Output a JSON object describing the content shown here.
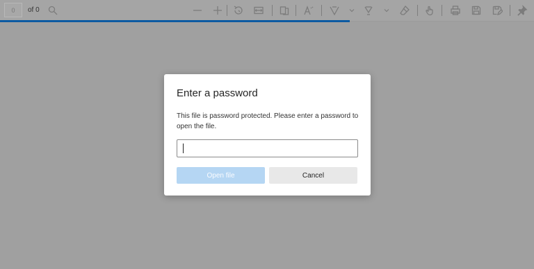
{
  "toolbar": {
    "page_number_value": "0",
    "page_count_label": "of 0",
    "icons": [
      "search-icon",
      "zoom-out-icon",
      "zoom-in-icon",
      "rotate-icon",
      "fit-page-icon",
      "page-view-icon",
      "read-aloud-icon",
      "draw-icon",
      "highlight-icon",
      "erase-icon",
      "touch-icon",
      "print-icon",
      "save-icon",
      "save-as-icon",
      "pin-icon"
    ]
  },
  "progress": {
    "fraction": 0.655,
    "color": "#0c5aa2"
  },
  "dialog": {
    "title": "Enter a password",
    "message": "This file is password protected. Please enter a password to open the file.",
    "password_value": "",
    "open_button_label": "Open file",
    "cancel_button_label": "Cancel"
  },
  "colors": {
    "overlay": "#a0a0a0",
    "accent": "#0c5aa2",
    "open_button_disabled": "#b5d6f3"
  }
}
